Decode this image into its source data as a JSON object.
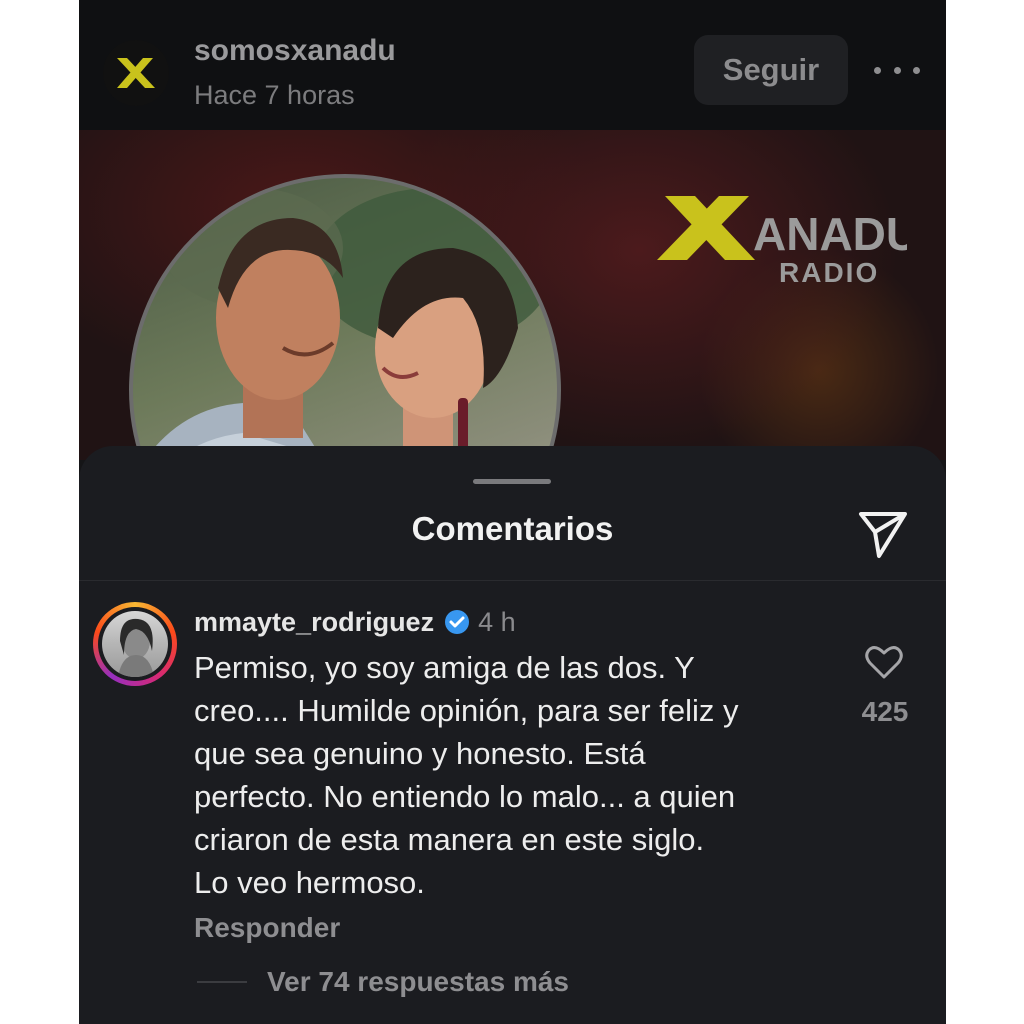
{
  "post_header": {
    "username": "somosxanadu",
    "timestamp": "Hace 7 horas",
    "follow_label": "Seguir",
    "more_icon": "more-horizontal-icon",
    "avatar_letter": "X"
  },
  "media": {
    "brand_name": "ANADU",
    "brand_sub": "RADIO",
    "brand_letter": "X",
    "accent_color": "#c9c21c"
  },
  "comments_sheet": {
    "title": "Comentarios",
    "share_icon": "send-icon"
  },
  "comment": {
    "username": "mmayte_rodriguez",
    "verified_icon": "verified-badge-icon",
    "time": "4 h",
    "text_lines": [
      "Permiso, yo soy amiga de las dos. Y",
      "creo.... Humilde opinión, para ser feliz y",
      "que sea genuino y honesto. Está",
      "perfecto. No entiendo lo malo... a quien",
      "criaron de esta manera en este siglo.",
      "Lo veo hermoso."
    ],
    "reply_label": "Responder",
    "like_icon": "heart-icon",
    "like_count": "425",
    "view_replies_label": "Ver 74 respuestas más"
  }
}
